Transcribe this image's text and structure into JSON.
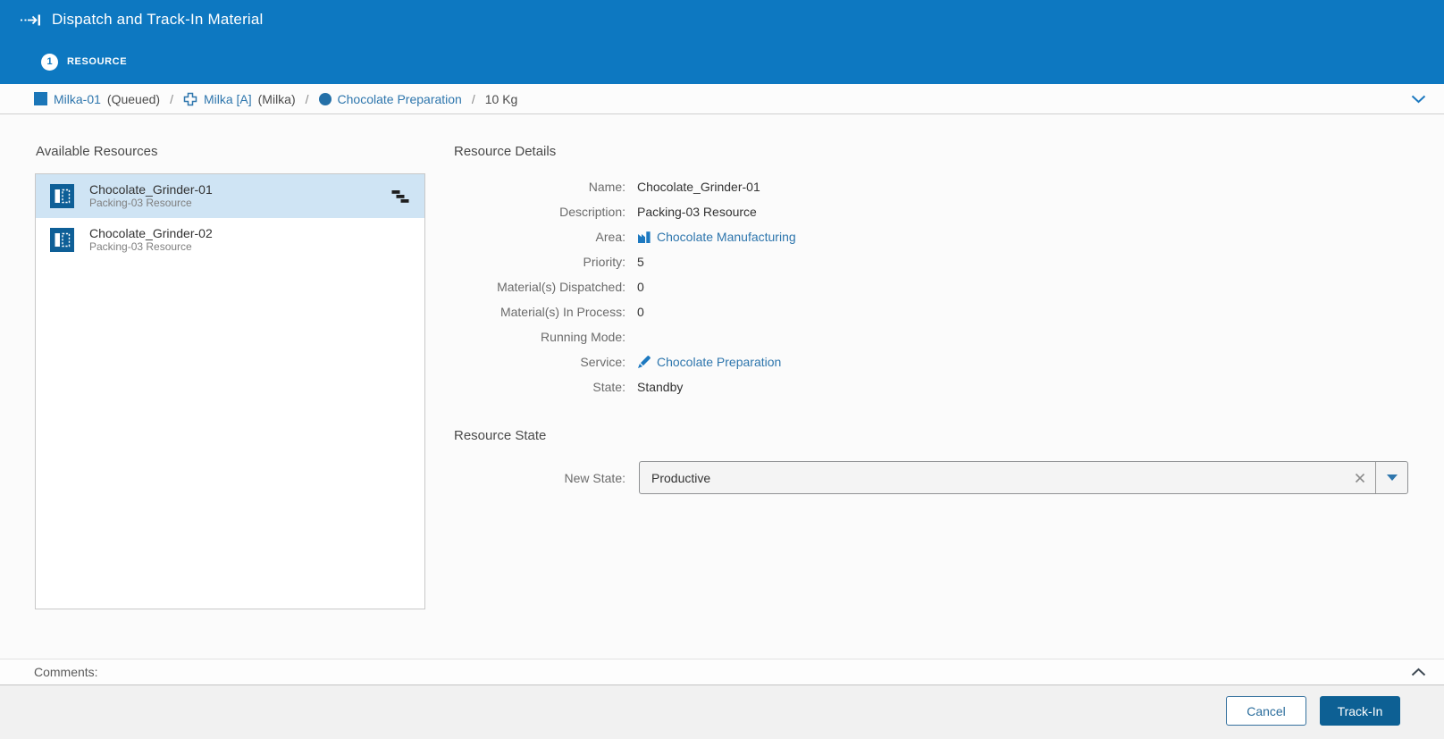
{
  "window": {
    "title": "Dispatch and Track-In Material"
  },
  "wizard": {
    "step_number": "1",
    "step_label": "RESOURCE"
  },
  "breadcrumb": {
    "separator": "/",
    "items": [
      {
        "label": "Milka-01",
        "meta": "(Queued)"
      },
      {
        "label": "Milka [A]",
        "meta": "(Milka)"
      },
      {
        "label": "Chocolate Preparation",
        "meta": ""
      },
      {
        "label": "10 Kg",
        "meta": ""
      }
    ]
  },
  "available_resources": {
    "title": "Available Resources",
    "items": [
      {
        "name": "Chocolate_Grinder-01",
        "description": "Packing-03 Resource"
      },
      {
        "name": "Chocolate_Grinder-02",
        "description": "Packing-03 Resource"
      }
    ]
  },
  "resource_details": {
    "title": "Resource Details",
    "rows": [
      {
        "label": "Name:",
        "value": "Chocolate_Grinder-01"
      },
      {
        "label": "Description:",
        "value": "Packing-03 Resource"
      },
      {
        "label": "Area:",
        "value": "Chocolate Manufacturing"
      },
      {
        "label": "Priority:",
        "value": "5"
      },
      {
        "label": "Material(s) Dispatched:",
        "value": "0"
      },
      {
        "label": "Material(s) In Process:",
        "value": "0"
      },
      {
        "label": "Running Mode:",
        "value": ""
      },
      {
        "label": "Service:",
        "value": "Chocolate Preparation"
      },
      {
        "label": "State:",
        "value": "Standby"
      }
    ]
  },
  "resource_state": {
    "title": "Resource State",
    "field_label": "New State:",
    "value": "Productive"
  },
  "comments": {
    "label": "Comments:"
  },
  "footer": {
    "cancel_label": "Cancel",
    "track_in_label": "Track-In"
  },
  "colors": {
    "header_blue": "#0d78c1",
    "accent_blue": "#2e76ad",
    "selection_bg": "#cfe4f4",
    "primary_button": "#0d6094"
  }
}
